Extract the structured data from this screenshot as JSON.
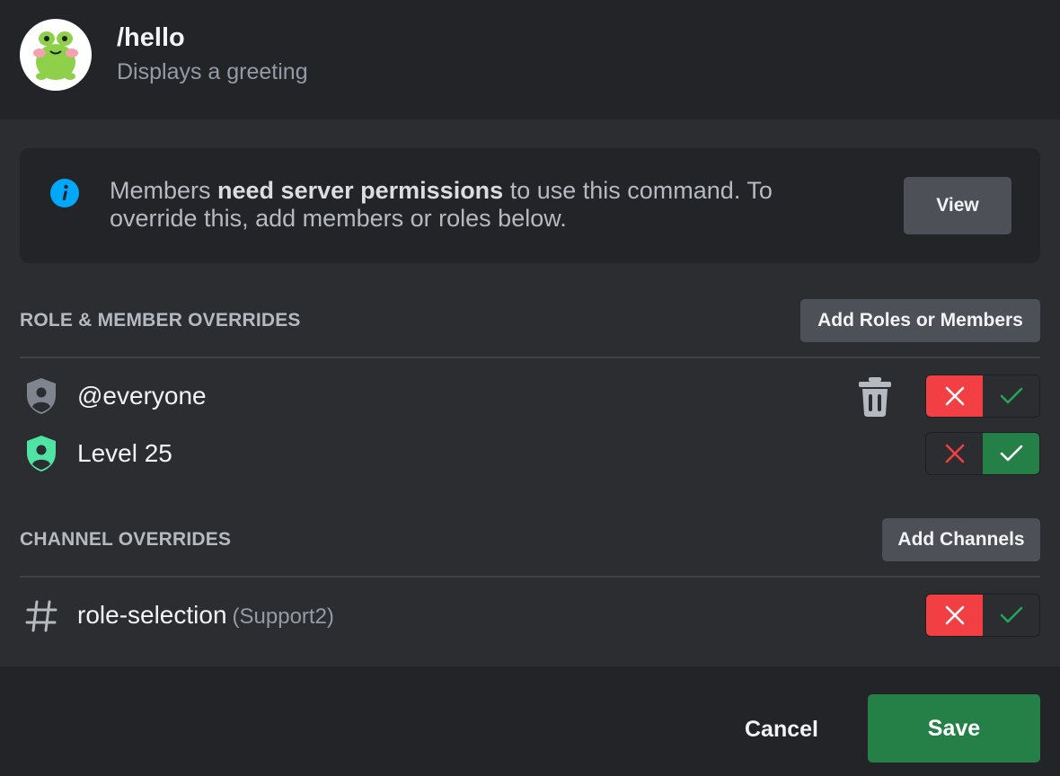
{
  "command": {
    "name": "/hello",
    "description": "Displays a greeting"
  },
  "notice": {
    "text_before": "Members ",
    "text_bold": "need server permissions",
    "text_after": " to use this command. To override this, add members or roles below.",
    "view_label": "View"
  },
  "role_overrides": {
    "title": "ROLE & MEMBER OVERRIDES",
    "add_label": "Add Roles or Members",
    "items": [
      {
        "name": "@everyone",
        "icon": "role-shield-icon",
        "state": "deny",
        "deletable": true
      },
      {
        "name": "Level 25",
        "icon": "role-shield-icon",
        "state": "allow",
        "deletable": false
      }
    ]
  },
  "channel_overrides": {
    "title": "CHANNEL OVERRIDES",
    "add_label": "Add Channels",
    "items": [
      {
        "name": "role-selection",
        "category": "(Support2)",
        "icon": "hashtag-icon",
        "state": "deny"
      }
    ]
  },
  "footer": {
    "cancel_label": "Cancel",
    "save_label": "Save"
  },
  "colors": {
    "deny": "#f23f43",
    "allow": "#248046",
    "role_everyone": "#80848e",
    "role_level25": "#4fe3a4",
    "info": "#00a8fc"
  }
}
